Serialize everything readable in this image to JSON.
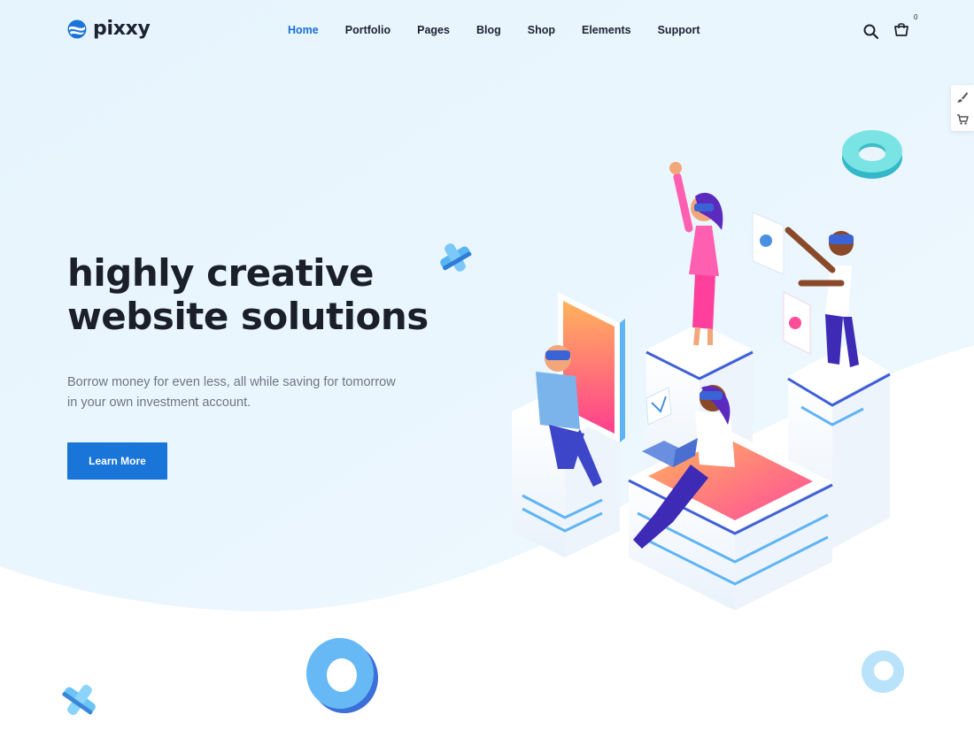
{
  "brand": {
    "name": "pixxy",
    "accent": "#1a75d9",
    "title_color": "#1b1f2a"
  },
  "nav": {
    "items": [
      {
        "label": "Home",
        "active": true
      },
      {
        "label": "Portfolio",
        "active": false
      },
      {
        "label": "Pages",
        "active": false
      },
      {
        "label": "Blog",
        "active": false
      },
      {
        "label": "Shop",
        "active": false
      },
      {
        "label": "Elements",
        "active": false
      },
      {
        "label": "Support",
        "active": false
      }
    ]
  },
  "header": {
    "search_icon": "search-icon",
    "cart_icon": "shopping-bag-icon",
    "cart_count": "0"
  },
  "side_panel": {
    "items": [
      "paintbrush-icon",
      "cart-icon"
    ]
  },
  "hero": {
    "title_line1": "highly creative",
    "title_line2": "website solutions",
    "text_line1": "Borrow money for even less, all while saving for tomorrow",
    "text_line2": "in your own investment account.",
    "cta_label": "Learn More"
  }
}
